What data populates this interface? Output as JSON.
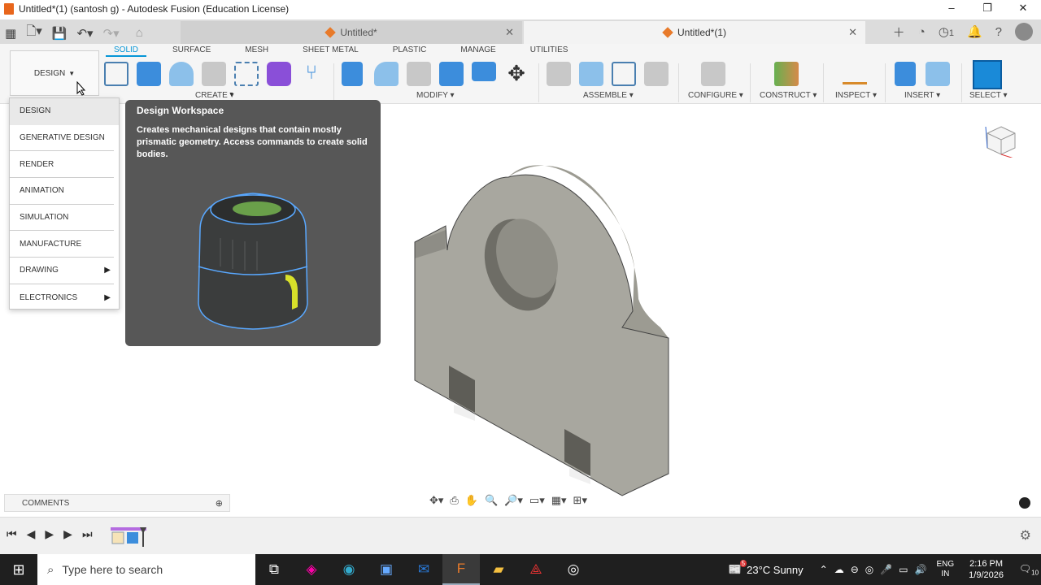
{
  "window": {
    "title": "Untitled*(1) (santosh g) - Autodesk Fusion (Education License)",
    "controls": [
      "–",
      "❐",
      "✕"
    ]
  },
  "tabs": [
    {
      "label": "Untitled*",
      "active": false
    },
    {
      "label": "Untitled*(1)",
      "active": true
    }
  ],
  "header": {
    "job_count": "1"
  },
  "ribbon": {
    "workspace_button": "DESIGN",
    "tabs": [
      "SOLID",
      "SURFACE",
      "MESH",
      "SHEET METAL",
      "PLASTIC",
      "MANAGE",
      "UTILITIES"
    ],
    "groups": [
      "CREATE",
      "MODIFY",
      "ASSEMBLE",
      "CONFIGURE",
      "CONSTRUCT",
      "INSPECT",
      "INSERT",
      "SELECT"
    ]
  },
  "workspace_menu": {
    "items": [
      {
        "label": "DESIGN",
        "active": true,
        "submenu": false
      },
      {
        "label": "GENERATIVE DESIGN",
        "active": false,
        "submenu": false
      },
      {
        "label": "RENDER",
        "active": false,
        "submenu": false
      },
      {
        "label": "ANIMATION",
        "active": false,
        "submenu": false
      },
      {
        "label": "SIMULATION",
        "active": false,
        "submenu": false
      },
      {
        "label": "MANUFACTURE",
        "active": false,
        "submenu": false
      },
      {
        "label": "DRAWING",
        "active": false,
        "submenu": true
      },
      {
        "label": "ELECTRONICS",
        "active": false,
        "submenu": true
      }
    ]
  },
  "tooltip": {
    "title": "Design Workspace",
    "description": "Creates mechanical designs that contain mostly prismatic geometry. Access commands to create solid bodies."
  },
  "comments": {
    "label": "COMMENTS"
  },
  "taskbar": {
    "search_placeholder": "Type here to search",
    "weather_badge": "5",
    "weather": "23°C  Sunny",
    "lang_1": "ENG",
    "lang_2": "IN",
    "time": "2:16 PM",
    "date": "1/9/2026",
    "notification_count": "10"
  },
  "colors": {
    "accent": "#0696d7",
    "ribbon_bg": "#f5f5f5",
    "tooltip_bg": "#575757",
    "taskbar_bg": "#1f1f1f",
    "model_face": "#a8a79f"
  }
}
